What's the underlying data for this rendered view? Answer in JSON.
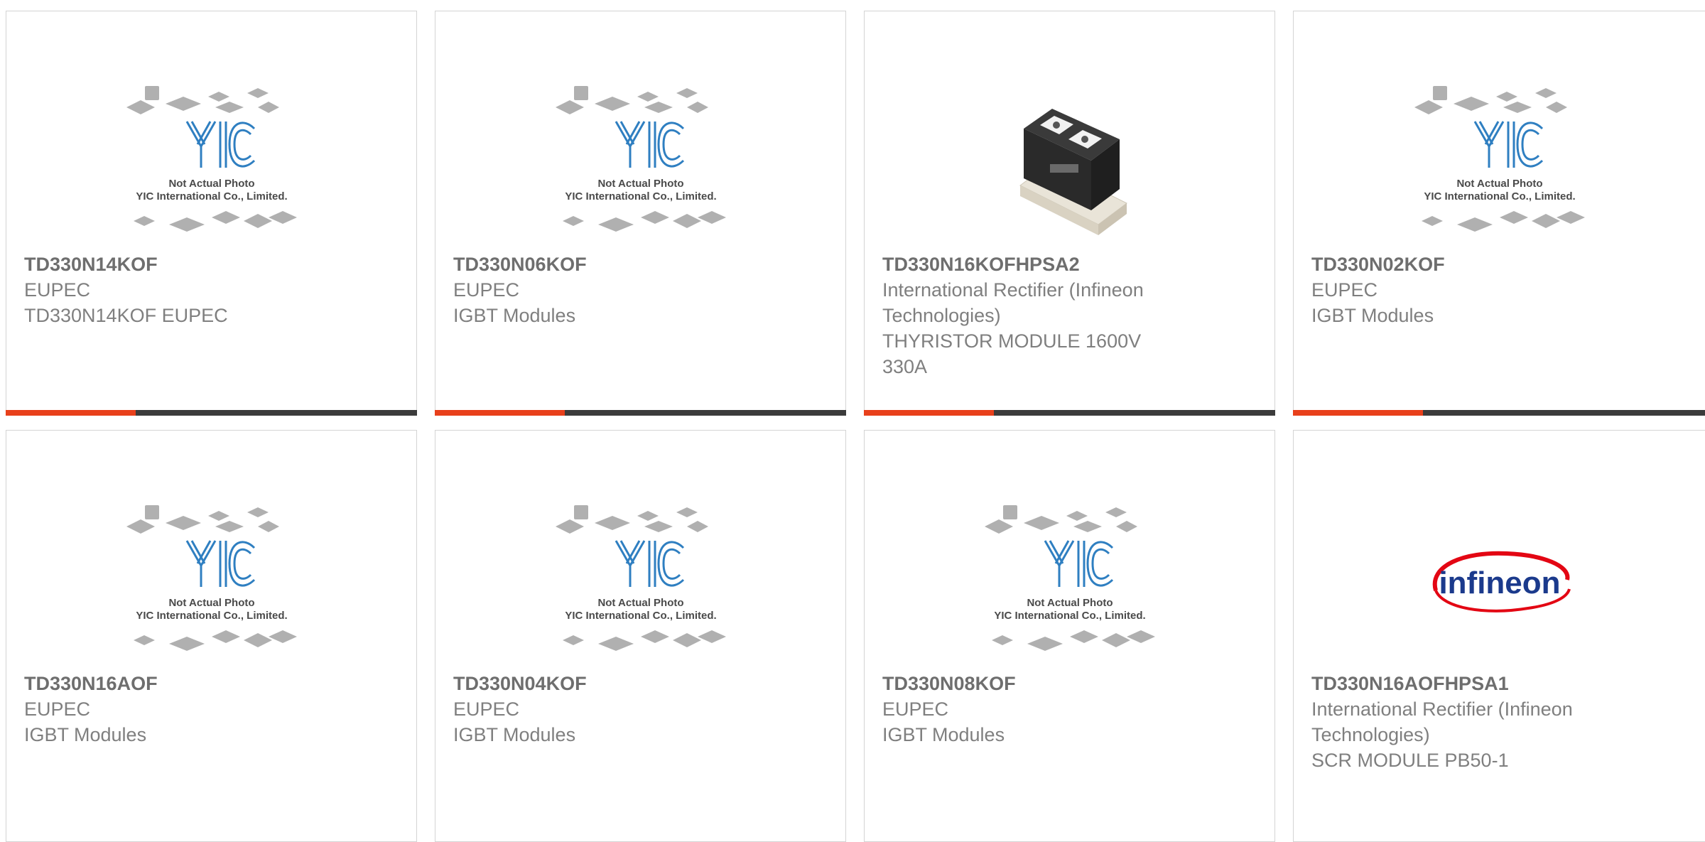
{
  "products": [
    {
      "part_number": "TD330N14KOF",
      "manufacturer": "EUPEC",
      "description": "TD330N14KOF EUPEC",
      "image": "placeholder-photo",
      "placeholder_caption": [
        "Not Actual Photo",
        "YIC International Co., Limited."
      ]
    },
    {
      "part_number": "TD330N06KOF",
      "manufacturer": "EUPEC",
      "description": "IGBT Modules",
      "image": "placeholder-photo",
      "placeholder_caption": [
        "Not Actual Photo",
        "YIC International Co., Limited."
      ]
    },
    {
      "part_number": "TD330N16KOFHPSA2",
      "manufacturer_lines": [
        "International Rectifier (Infineon",
        "Technologies)"
      ],
      "description_lines": [
        "THYRISTOR MODULE 1600V",
        "330A"
      ],
      "image": "thyristor-module-photo"
    },
    {
      "part_number": "TD330N02KOF",
      "manufacturer": "EUPEC",
      "description": "IGBT Modules",
      "image": "placeholder-photo",
      "placeholder_caption": [
        "Not Actual Photo",
        "YIC International Co., Limited."
      ]
    },
    {
      "part_number": "TD330N16AOF",
      "manufacturer": "EUPEC",
      "description": "IGBT Modules",
      "image": "placeholder-photo",
      "placeholder_caption": [
        "Not Actual Photo",
        "YIC International Co., Limited."
      ]
    },
    {
      "part_number": "TD330N04KOF",
      "manufacturer": "EUPEC",
      "description": "IGBT Modules",
      "image": "placeholder-photo",
      "placeholder_caption": [
        "Not Actual Photo",
        "YIC International Co., Limited."
      ]
    },
    {
      "part_number": "TD330N08KOF",
      "manufacturer": "EUPEC",
      "description": "IGBT Modules",
      "image": "placeholder-photo",
      "placeholder_caption": [
        "Not Actual Photo",
        "YIC International Co., Limited."
      ]
    },
    {
      "part_number": "TD330N16AOFHPSA1",
      "manufacturer_lines": [
        "International Rectifier (Infineon",
        "Technologies)"
      ],
      "description": "SCR MODULE PB50-1",
      "image": "infineon-logo",
      "logo_text": "infineon"
    }
  ],
  "colors": {
    "accent": "#e8401b",
    "bar": "#3b3b3b",
    "placeholder_logo": "#2f7fc1",
    "infineon_text": "#1b3a8c",
    "infineon_swoosh": "#e30613"
  }
}
